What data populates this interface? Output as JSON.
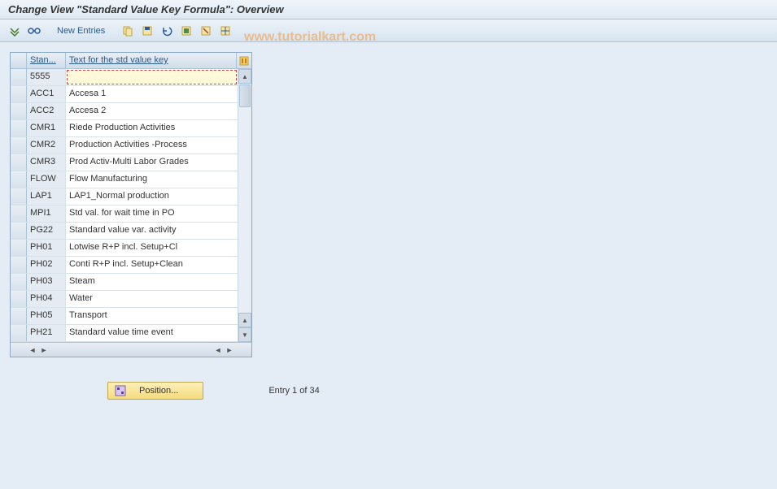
{
  "title": "Change View \"Standard Value Key Formula\": Overview",
  "toolbar": {
    "new_entries": "New Entries"
  },
  "watermark": "www.tutorialkart.com",
  "table": {
    "headers": {
      "col1": "Stan...",
      "col2": "Text for the std value key"
    },
    "rows": [
      {
        "key": "5555",
        "text": "",
        "active": true
      },
      {
        "key": "ACC1",
        "text": "Accesa 1"
      },
      {
        "key": "ACC2",
        "text": "Accesa 2"
      },
      {
        "key": "CMR1",
        "text": "Riede Production Activities"
      },
      {
        "key": "CMR2",
        "text": "Production Activities -Process"
      },
      {
        "key": "CMR3",
        "text": "Prod Activ-Multi Labor Grades"
      },
      {
        "key": "FLOW",
        "text": "Flow Manufacturing"
      },
      {
        "key": "LAP1",
        "text": "LAP1_Normal production"
      },
      {
        "key": "MPI1",
        "text": "Std val. for wait time in PO"
      },
      {
        "key": "PG22",
        "text": "Standard value var. activity"
      },
      {
        "key": "PH01",
        "text": "Lotwise R+P incl. Setup+Cl"
      },
      {
        "key": "PH02",
        "text": "Conti R+P incl. Setup+Clean"
      },
      {
        "key": "PH03",
        "text": "Steam"
      },
      {
        "key": "PH04",
        "text": "Water"
      },
      {
        "key": "PH05",
        "text": "Transport"
      },
      {
        "key": "PH21",
        "text": "Standard value time event"
      }
    ]
  },
  "button": {
    "position": "Position..."
  },
  "status": {
    "entry": "Entry 1 of 34"
  }
}
